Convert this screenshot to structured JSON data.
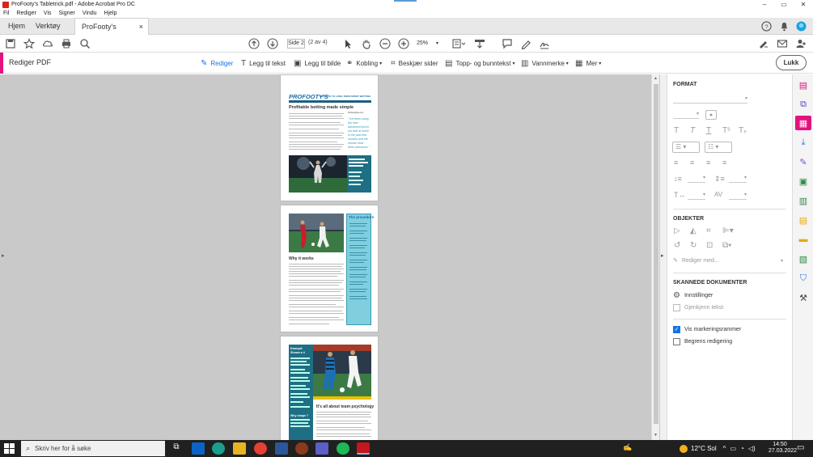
{
  "window": {
    "title": "ProFooty's Tabletrick.pdf - Adobe Acrobat Pro DC",
    "controls": {
      "minimize": "–",
      "maximize": "▭",
      "close": "✕"
    }
  },
  "menu": [
    "Fil",
    "Rediger",
    "Vis",
    "Signer",
    "Vindu",
    "Hjelp"
  ],
  "tabs": {
    "home": "Hjem",
    "tools": "Verktøy",
    "document": "ProFooty's Tabletric...",
    "close": "×"
  },
  "toolbar": {
    "page_value": "Side 2",
    "page_count": "(2 av 4)",
    "zoom": "25%"
  },
  "editbar": {
    "heading": "Rediger PDF",
    "buttons": [
      "Rediger",
      "Legg til tekst",
      "Legg til bilde",
      "Kobling",
      "Beskjær sider",
      "Topp- og bunntekst",
      "Vannmerke",
      "Mer"
    ],
    "close": "Lukk"
  },
  "document": {
    "page1": {
      "masthead": "PROFOOTY'S",
      "tagline": "SECRETS TO LONG TERM SPORT BETTING",
      "headline": "Profitable betting made simple",
      "sidebar_title": "Profootytips.com",
      "quote": "\" Ive been using the new advanced tool in our trial at home in the past few months and the results have been awesome. \""
    },
    "page2": {
      "sidebar_title": "The procedure",
      "section_title": "Why it works"
    },
    "page3": {
      "sidebar_title": "Example Shown a 4",
      "heading": "It's all about team psychology",
      "section_title": "Why shape ?"
    }
  },
  "right_panel": {
    "format_title": "FORMAT",
    "objects_title": "OBJEKTER",
    "edit_with": "Rediger med...",
    "scanned_title": "SKANNEDE DOKUMENTER",
    "settings": "Innstillinger",
    "recognize_text": "Gjenkjenn tekst",
    "show_frames": "Vis markeringsrammer",
    "restrict_editing": "Begrens redigering",
    "show_frames_checked": true,
    "restrict_editing_checked": false
  },
  "taskbar": {
    "search_placeholder": "Skriv her for å søke",
    "weather": "12°C Sol",
    "time": "14:50",
    "date": "27.03.2022"
  },
  "colors": {
    "accent": "#e3127f",
    "taskbar": "#202020",
    "doc_bg": "#c9c9c9",
    "check": "#1473e6"
  }
}
